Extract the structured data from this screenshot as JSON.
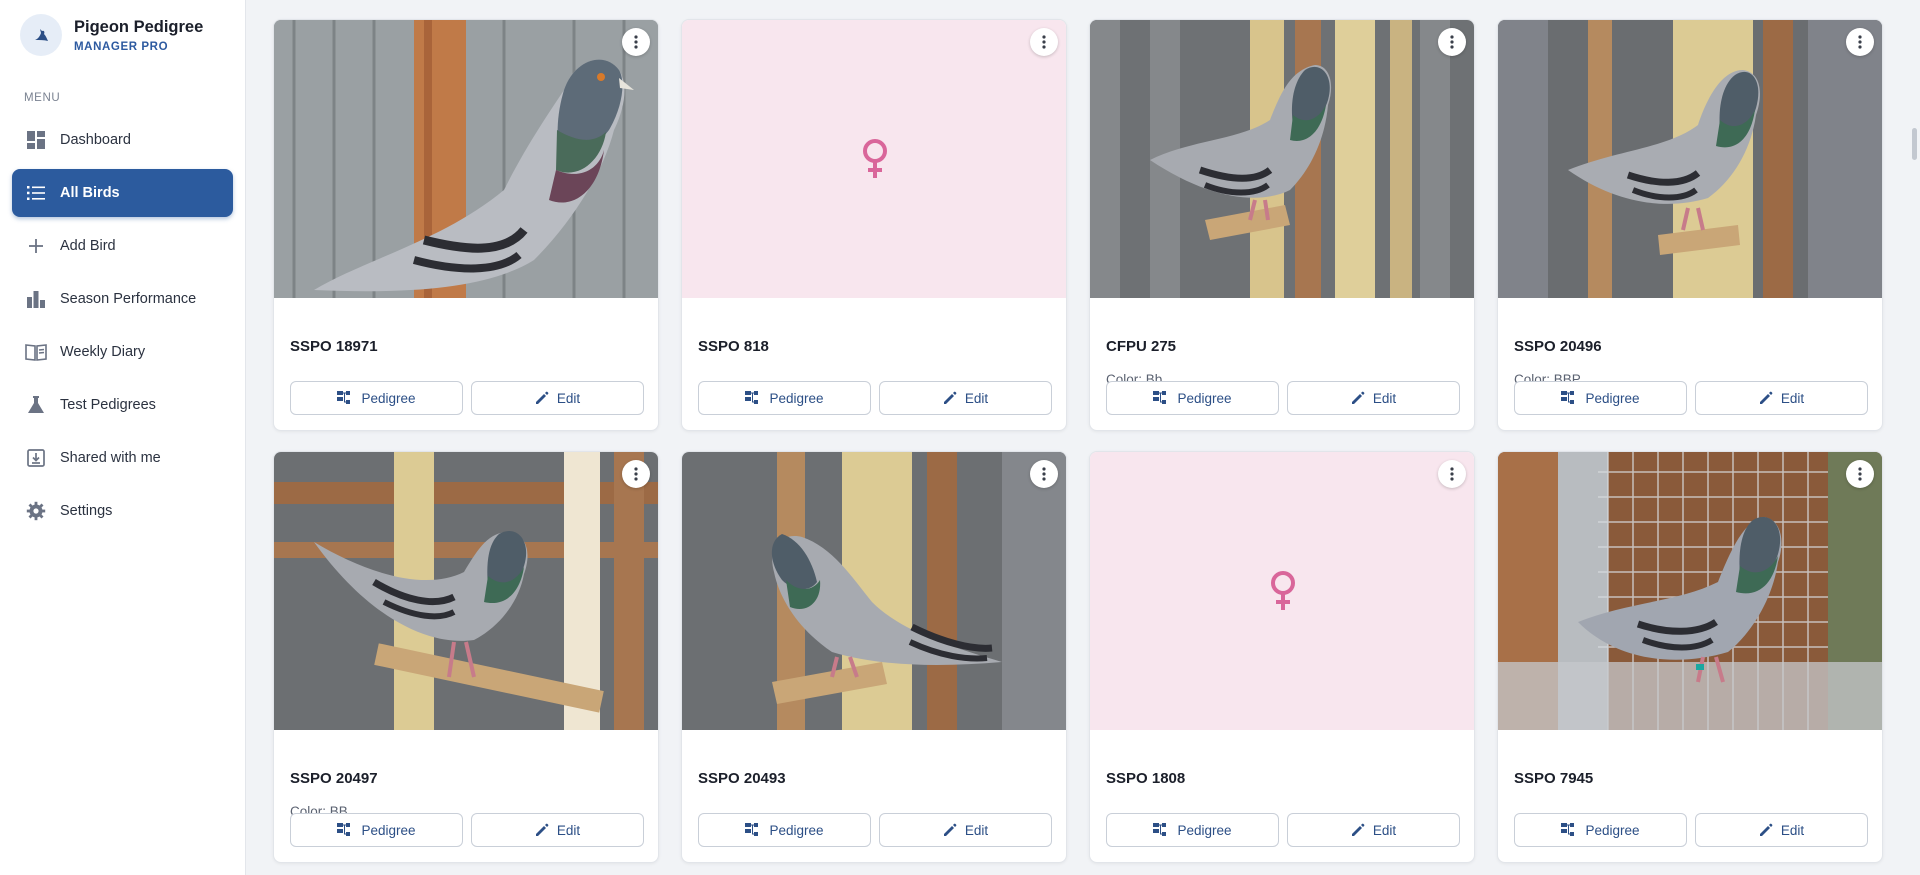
{
  "app": {
    "name": "Pigeon Pedigree",
    "subtitle": "MANAGER PRO"
  },
  "sidebar": {
    "menu_label": "MENU",
    "items": [
      {
        "label": "Dashboard",
        "icon": "dashboard-icon"
      },
      {
        "label": "All Birds",
        "icon": "list-icon",
        "active": true
      },
      {
        "label": "Add Bird",
        "icon": "plus-icon"
      },
      {
        "label": "Season Performance",
        "icon": "bar-chart-icon"
      },
      {
        "label": "Weekly Diary",
        "icon": "book-icon"
      },
      {
        "label": "Test Pedigrees",
        "icon": "flask-icon"
      },
      {
        "label": "Shared with me",
        "icon": "download-box-icon"
      },
      {
        "label": "Settings",
        "icon": "gear-icon"
      }
    ]
  },
  "birds": [
    {
      "name": "SSPO 18971",
      "color": "",
      "photo": true
    },
    {
      "name": "SSPO 818",
      "color": "",
      "photo": false,
      "placeholder": "female-icon"
    },
    {
      "name": "CFPU 275",
      "color": "Color: Bb",
      "photo": true
    },
    {
      "name": "SSPO 20496",
      "color": "Color: BBP",
      "photo": true
    },
    {
      "name": "SSPO 20497",
      "color": "Color: BB",
      "photo": true
    },
    {
      "name": "SSPO 20493",
      "color": "",
      "photo": true
    },
    {
      "name": "SSPO 1808",
      "color": "",
      "photo": false,
      "placeholder": "female-icon"
    },
    {
      "name": "SSPO 7945",
      "color": "",
      "photo": true
    }
  ],
  "card_actions": {
    "pedigree_label": "Pedigree",
    "edit_label": "Edit"
  },
  "colors": {
    "accent": "#2c5b9e",
    "placeholder_bg": "#f8e6ee",
    "female_symbol": "#d9669a"
  }
}
